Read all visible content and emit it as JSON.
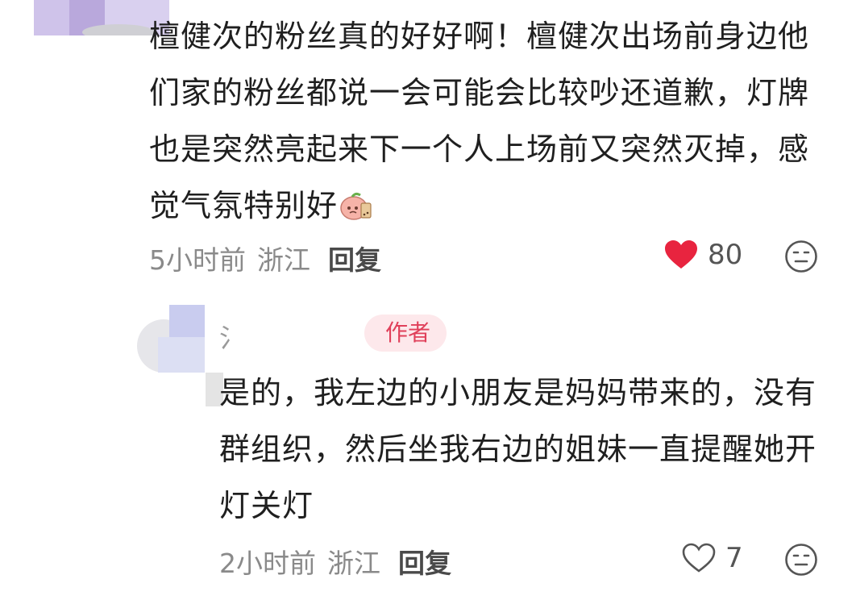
{
  "main_comment": {
    "text": "檀健次的粉丝真的好好啊！檀健次出场前身边他们家的粉丝都说一会可能会比较吵还道歉，灯牌也是突然亮起来下一个人上场前又突然灭掉，感觉气氛特别好",
    "time": "5小时前",
    "location": "浙江",
    "reply_label": "回复",
    "likes": "80",
    "liked": true
  },
  "reply_comment": {
    "username": "氵",
    "badge": "作者",
    "text": "是的，我左边的小朋友是妈妈带来的，没有群组织，然后坐我右边的姐妹一直提醒她开灯关灯",
    "time": "2小时前",
    "location": "浙江",
    "reply_label": "回复",
    "likes": "7",
    "liked": false
  },
  "icons": {
    "like_filled": "heart-filled-icon",
    "like_outline": "heart-outline-icon",
    "dislike": "unhappy-face-icon",
    "sticker": "peach-boba-sticker"
  },
  "colors": {
    "heart": "#e8243f",
    "badge_bg": "#fde8eb",
    "badge_text": "#e0405a",
    "meta": "#8a8a8a"
  }
}
